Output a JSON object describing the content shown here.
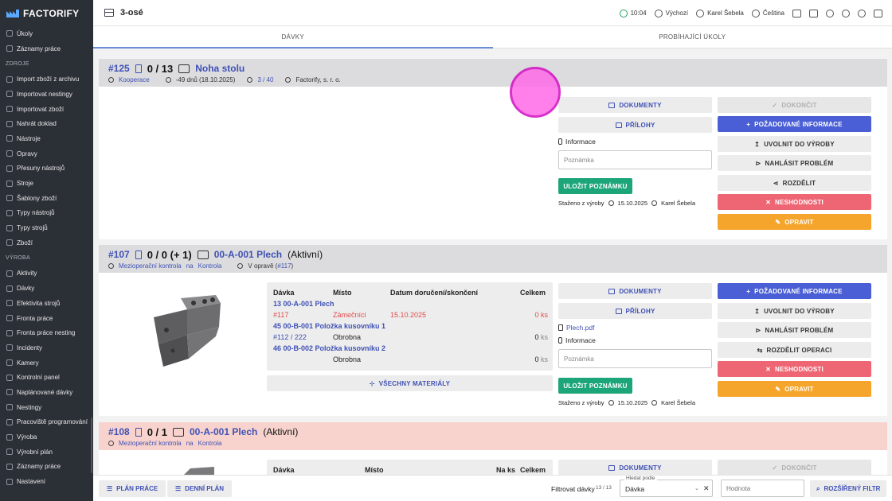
{
  "brand": {
    "name": "FACTORIFY"
  },
  "sidebar": {
    "group0": [
      {
        "label": "Úkoly"
      },
      {
        "label": "Záznamy práce"
      }
    ],
    "section1": "ZDROJE",
    "group1": [
      {
        "label": "Import zboží z archivu"
      },
      {
        "label": "Importovat nestingy"
      },
      {
        "label": "Importovat zboží"
      },
      {
        "label": "Nahrát doklad"
      },
      {
        "label": "Nástroje"
      },
      {
        "label": "Opravy"
      },
      {
        "label": "Přesuny nástrojů"
      },
      {
        "label": "Stroje"
      },
      {
        "label": "Šablony zboží"
      },
      {
        "label": "Typy nástrojů"
      },
      {
        "label": "Typy strojů"
      },
      {
        "label": "Zboží"
      }
    ],
    "section2": "VÝROBA",
    "group2": [
      {
        "label": "Aktivity"
      },
      {
        "label": "Dávky"
      },
      {
        "label": "Efektivita strojů"
      },
      {
        "label": "Fronta práce"
      },
      {
        "label": "Fronta práce nesting"
      },
      {
        "label": "Incidenty"
      },
      {
        "label": "Kamery"
      },
      {
        "label": "Kontrolní panel"
      },
      {
        "label": "Naplánované dávky"
      },
      {
        "label": "Nestingy"
      },
      {
        "label": "Pracoviště programování"
      },
      {
        "label": "Výroba"
      },
      {
        "label": "Výrobní plán"
      },
      {
        "label": "Záznamy práce"
      },
      {
        "label": "Nastavení"
      }
    ]
  },
  "topbar": {
    "title": "3-osé",
    "time": "10:04",
    "currency": "Výchozí",
    "user": "Karel Šebela",
    "language": "Čeština"
  },
  "tabs": [
    {
      "label": "DÁVKY"
    },
    {
      "label": "PROBÍHAJÍCÍ ÚKOLY"
    }
  ],
  "cards": [
    {
      "id": "#125",
      "count": "0 / 13",
      "item": "Noha stolu",
      "status": "",
      "type": "Kooperace",
      "deadline": "-49 dnů (18.10.2025)",
      "cart": "3 / 40",
      "company": "Factorify, s. r. o.",
      "buttons": {
        "documents": "DOKUMENTY",
        "attachments": "PŘÍLOHY",
        "finish": "DOKONČIT",
        "required_info": "POŽADOVANÉ INFORMACE",
        "release": "UVOLNIT DO VÝROBY",
        "report": "NAHLÁSIT PROBLÉM",
        "split": "ROZDĚLIT",
        "nonconformity": "NESHODNOSTI",
        "repair": "OPRAVIT",
        "save_note": "ULOŽIT POZNÁMKU"
      },
      "info_label": "Informace",
      "note_placeholder": "Poznámka",
      "downloaded": "Staženo z výroby",
      "downloaded_date": "15.10.2025",
      "downloaded_by": "Karel Šebela"
    },
    {
      "id": "#107",
      "count": "0 / 0 (+ 1)",
      "item": "00-A-001 Plech",
      "status": "(Aktivní)",
      "type": "Mezioperační kontrola",
      "on": "na",
      "on_target": "Kontrola",
      "repair_label": "V opravě (",
      "repair_ref": "#117",
      "repair_close": ")",
      "materials": {
        "headers": {
          "batch": "Dávka",
          "place": "Místo",
          "date": "Datum doručení/skončení",
          "total": "Celkem"
        },
        "rows": [
          {
            "title": "13 00-A-001 Plech",
            "batch": "#117",
            "place": "Zámečníci",
            "date": "15.10.2025",
            "total": "0",
            "unit": "ks"
          },
          {
            "title": "45 00-B-001 Položka kusovníku 1",
            "batch": "#112 / 222",
            "place": "Obrobna",
            "date": "",
            "total": "0",
            "unit": "ks"
          },
          {
            "title": "46 00-B-002 Položka kusovníku 2",
            "batch": "",
            "place": "Obrobna",
            "date": "",
            "total": "0",
            "unit": "ks"
          }
        ],
        "all_button": "VŠECHNY MATERIÁLY"
      },
      "file": "Plech.pdf",
      "buttons": {
        "documents": "DOKUMENTY",
        "attachments": "PŘÍLOHY",
        "required_info": "POŽADOVANÉ INFORMACE",
        "release": "UVOLNIT DO VÝROBY",
        "report": "NAHLÁSIT PROBLÉM",
        "split": "ROZDĚLIT OPERACI",
        "nonconformity": "NESHODNOSTI",
        "repair": "OPRAVIT",
        "save_note": "ULOŽIT POZNÁMKU"
      },
      "info_label": "Informace",
      "note_placeholder": "Poznámka",
      "downloaded": "Staženo z výroby",
      "downloaded_date": "15.10.2025",
      "downloaded_by": "Karel Šebela"
    },
    {
      "id": "#108",
      "count": "0 / 1",
      "item": "00-A-001 Plech",
      "status": "(Aktivní)",
      "type": "Mezioperační kontrola",
      "on": "na",
      "on_target": "Kontrola",
      "headers": {
        "batch": "Dávka",
        "place": "Místo",
        "per_piece": "Na ks",
        "total": "Celkem"
      },
      "buttons": {
        "documents": "DOKUMENTY",
        "finish": "DOKONČIT"
      }
    }
  ],
  "bottombar": {
    "plan_work": "PLÁN PRÁCE",
    "daily_plan": "DENNÍ PLÁN",
    "filter_label": "Filtrovat dávky",
    "filter_count": "13 / 13",
    "search_by_legend": "Hledat podle",
    "search_by_value": "Dávka",
    "value_placeholder": "Hodnota",
    "extended_filter": "ROZŠÍŘENÝ FILTR"
  },
  "colors": {
    "accent": "#3f51b5",
    "primary": "#4a5fd5",
    "danger": "#ee6673",
    "warning": "#f5a52b",
    "success": "#1da57a",
    "sidebar": "#2b2f36"
  }
}
